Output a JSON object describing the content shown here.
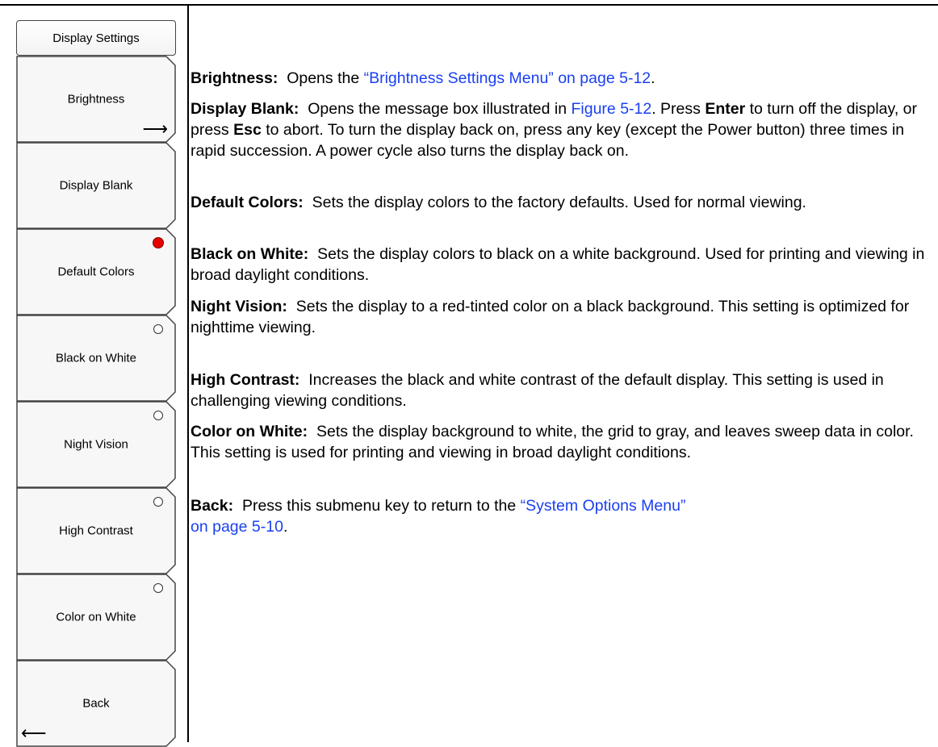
{
  "menu": {
    "title": "Display Settings",
    "keys": [
      {
        "label": "Brightness",
        "indicator": "arrow-right"
      },
      {
        "label": "Display Blank",
        "indicator": "none"
      },
      {
        "label": "Default Colors",
        "indicator": "radio-selected"
      },
      {
        "label": "Black on White",
        "indicator": "radio-empty"
      },
      {
        "label": "Night Vision",
        "indicator": "radio-empty"
      },
      {
        "label": "High Contrast",
        "indicator": "radio-empty"
      },
      {
        "label": "Color on White",
        "indicator": "radio-empty"
      },
      {
        "label": "Back",
        "indicator": "arrow-left"
      }
    ],
    "arrows": {
      "right": "⟶",
      "left": "⟵"
    },
    "selected_color": "#e60000"
  },
  "descriptions": {
    "brightness": {
      "term": "Brightness:",
      "text1": "  Opens the ",
      "link": "“Brightness Settings Menu” on page 5-12",
      "text2": "."
    },
    "display_blank": {
      "term": "Display Blank:",
      "text1": "  Opens the message box illustrated in ",
      "link": "Figure 5-12",
      "text2": ". Press ",
      "key1": "Enter",
      "text3": " to turn off the display, or press ",
      "key2": "Esc",
      "text4": " to abort. To turn the display back on, press any key (except the Power button) three times in rapid succession. A power cycle also turns the display back on."
    },
    "default_colors": {
      "term": "Default Colors:",
      "text": "  Sets the display colors to the factory defaults. Used for normal viewing."
    },
    "black_on_white": {
      "term": "Black on White:",
      "text": "  Sets the display colors to black on a white background. Used for printing and viewing in broad daylight conditions."
    },
    "night_vision": {
      "term": "Night Vision:",
      "text": "  Sets the display to a red-tinted color on a black background. This setting is optimized for nighttime viewing."
    },
    "high_contrast": {
      "term": "High Contrast:",
      "text": "  Increases the black and white contrast of the default display. This setting is used in challenging viewing conditions."
    },
    "color_on_white": {
      "term": "Color on White:",
      "text": "  Sets the display background to white, the grid to gray, and leaves sweep data in color. This setting is used for printing and viewing in broad daylight conditions."
    },
    "back": {
      "term": "Back:",
      "text1": "  Press this submenu key to return to the ",
      "link": "“System Options Menu” on page 5-10",
      "text2": "."
    }
  }
}
